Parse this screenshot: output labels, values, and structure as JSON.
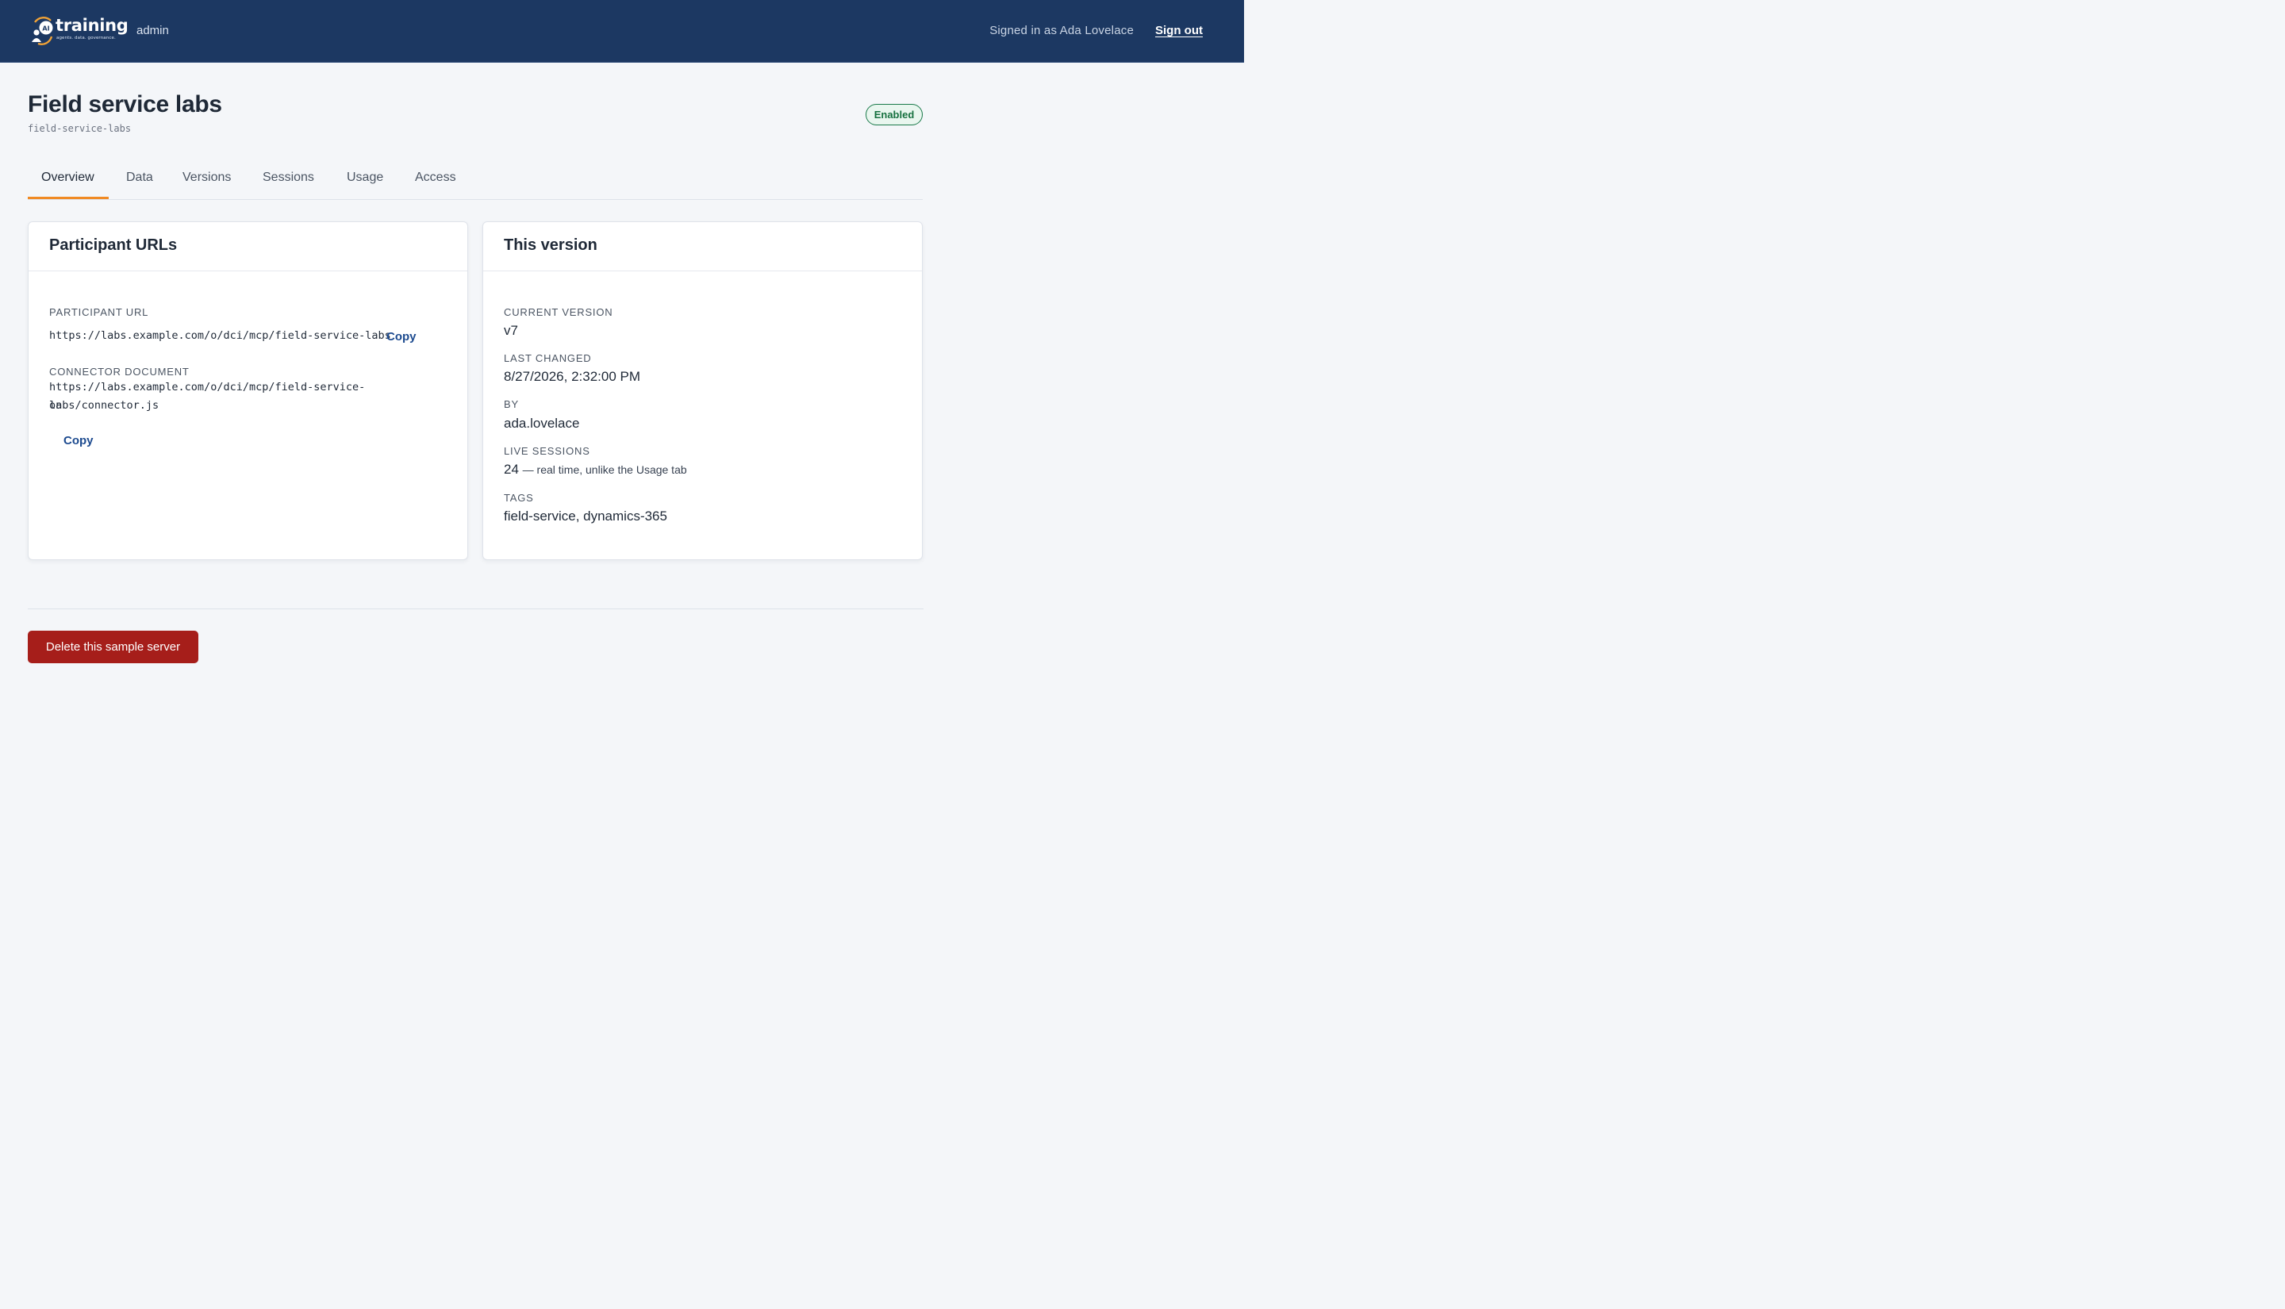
{
  "header": {
    "logo_text": "training",
    "logo_badge": "AI",
    "logo_tagline": "agents. data. governance.",
    "section": "admin",
    "signed_in": "Signed in as Ada Lovelace",
    "sign_out": "Sign out"
  },
  "page": {
    "title": "Field service labs",
    "slug": "field-service-labs",
    "status": "Enabled"
  },
  "tabs": [
    {
      "label": "Overview",
      "active": true
    },
    {
      "label": "Data",
      "active": false
    },
    {
      "label": "Versions",
      "active": false
    },
    {
      "label": "Sessions",
      "active": false
    },
    {
      "label": "Usage",
      "active": false
    },
    {
      "label": "Access",
      "active": false
    }
  ],
  "participant_card": {
    "title": "Participant URLs",
    "participant_url_label": "PARTICIPANT URL",
    "participant_url": "https://labs.example.com/o/dci/mcp/field-service-labs",
    "connector_label": "CONNECTOR DOCUMENT",
    "connector_url_line1": "https://labs.example.com/o/dci/mcp/field-service-labs/connector.js",
    "connector_url_line2": "on",
    "copy_label": "Copy"
  },
  "version_card": {
    "title": "This version",
    "current_version_label": "CURRENT VERSION",
    "current_version": "v7",
    "last_changed_label": "LAST CHANGED",
    "last_changed": "8/27/2026, 2:32:00 PM",
    "by_label": "BY",
    "by": "ada.lovelace",
    "live_sessions_label": "LIVE SESSIONS",
    "live_sessions": "24",
    "live_sessions_note": "— real time, unlike the Usage tab",
    "tags_label": "TAGS",
    "tags": "field-service, dynamics-365"
  },
  "actions": {
    "delete_label": "Delete this sample server"
  },
  "colors": {
    "header_bg": "#1c3862",
    "accent_tab": "#f08a24",
    "badge_green": "#16703f",
    "danger": "#a61e1a",
    "link": "#1c4a8f"
  }
}
